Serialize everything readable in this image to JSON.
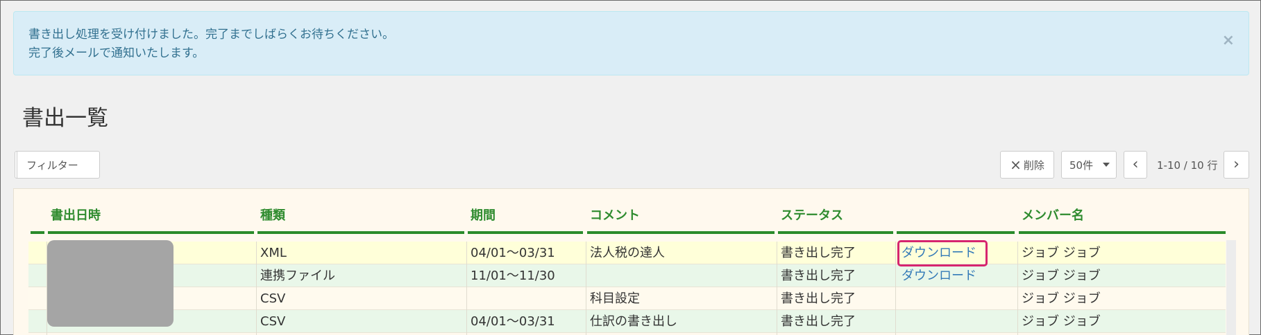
{
  "alert": {
    "line1": "書き出し処理を受け付けました。完了までしばらくお待ちください。",
    "line2": "完了後メールで通知いたします。",
    "close_label": "×"
  },
  "page_title": "書出一覧",
  "toolbar": {
    "filter_label": "フィルター",
    "delete_label": "削除",
    "delete_icon": "×",
    "per_page": "50件",
    "prev_icon": "‹",
    "next_icon": "›",
    "pagination": "1-10 / 10 行"
  },
  "table": {
    "headers": [
      "書出日時",
      "種類",
      "期間",
      "コメント",
      "ステータス",
      "",
      "メンバー名"
    ],
    "rows": [
      {
        "type": "XML",
        "period": "04/01～03/31",
        "comment": "法人税の達人",
        "status": "書き出し完了",
        "action": "ダウンロード",
        "member": "ジョブ ジョブ"
      },
      {
        "type": "連携ファイル",
        "period": "11/01～11/30",
        "comment": "",
        "status": "書き出し完了",
        "action": "ダウンロード",
        "member": "ジョブ ジョブ"
      },
      {
        "type": "CSV",
        "period": "",
        "comment": "科目設定",
        "status": "書き出し完了",
        "action": "",
        "member": "ジョブ ジョブ"
      },
      {
        "type": "CSV",
        "period": "04/01～03/31",
        "comment": "仕訳の書き出し",
        "status": "書き出し完了",
        "action": "",
        "member": "ジョブ ジョブ"
      }
    ]
  },
  "colors": {
    "header_green": "#2e8b2e",
    "link_blue": "#337ab7",
    "highlight_pink": "#d6256f",
    "alert_bg": "#d9edf7"
  }
}
